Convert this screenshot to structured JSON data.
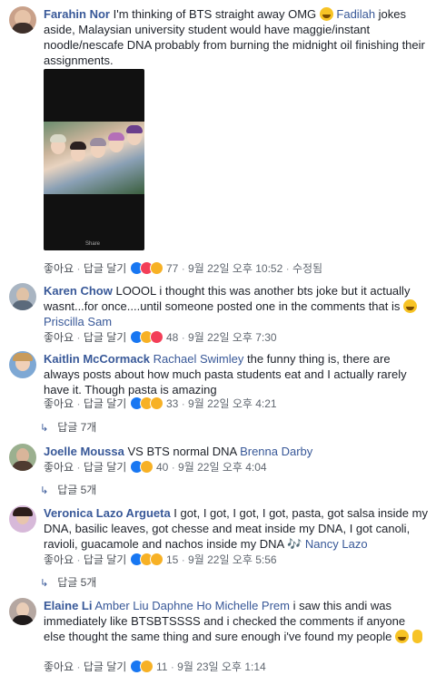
{
  "comments": [
    {
      "author": "Farahin Nor",
      "text1": "I'm thinking of BTS straight away OMG",
      "mention": "Fadilah",
      "text2": "jokes aside, Malaysian university student would have maggie/instant noodle/nescafe DNA probably from burning the midnight oil finishing their assignments.",
      "like": "좋아요",
      "reply": "답글 달기",
      "count": "77",
      "time": "9월 22일 오후 10:52",
      "extra": "수정됨"
    },
    {
      "author": "Karen Chow",
      "text1": "LOOOL i thought this was another bts joke but it actually wasnt...for once....until someone posted one in the comments that is",
      "mention": "Priscilla Sam",
      "like": "좋아요",
      "reply": "답글 달기",
      "count": "48",
      "time": "9월 22일 오후 7:30"
    },
    {
      "author": "Kaitlin McCormack",
      "mention": "Rachael Swimley",
      "text1": "the funny thing is, there are always posts about how much pasta students eat and I actually rarely have it. Though pasta is amazing",
      "like": "좋아요",
      "reply": "답글 달기",
      "count": "33",
      "time": "9월 22일 오후 4:21",
      "replies": "답글 7개"
    },
    {
      "author": "Joelle Moussa",
      "text1": "VS BTS normal DNA",
      "mention": "Brenna Darby",
      "like": "좋아요",
      "reply": "답글 달기",
      "count": "40",
      "time": "9월 22일 오후 4:04",
      "replies": "답글 5개"
    },
    {
      "author": "Veronica Lazo Argueta",
      "text1": "I got, I got, I got, I got, pasta, got salsa inside my DNA, basilic leaves, got chesse and meat inside my DNA, I got canoli, ravioli, guacamole and nachos inside my DNA 🎶",
      "mention": "Nancy Lazo",
      "like": "좋아요",
      "reply": "답글 달기",
      "count": "15",
      "time": "9월 22일 오후 5:56",
      "replies": "답글 5개"
    },
    {
      "author": "Elaine Li",
      "mentions": "Amber Liu Daphne Ho Michelle Prem",
      "text1": "i saw this andi was immediately like BTSBTSSSS and i checked the comments if anyone else thought the same thing and sure enough i've found my people",
      "like": "좋아요",
      "reply": "답글 달기",
      "count": "11",
      "time": "9월 23일 오후 1:14"
    }
  ],
  "photo": {
    "share": "Share"
  },
  "colors": {
    "link": "#385898",
    "text": "#1d2129",
    "meta": "#606770"
  }
}
